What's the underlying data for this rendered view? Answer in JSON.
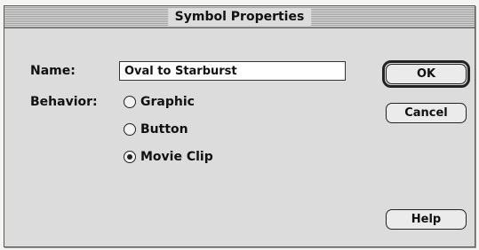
{
  "dialog": {
    "title": "Symbol Properties",
    "name_label": "Name:",
    "name_value": "Oval to Starburst",
    "behavior_label": "Behavior:",
    "behavior_options": [
      {
        "label": "Graphic",
        "selected": false
      },
      {
        "label": "Button",
        "selected": false
      },
      {
        "label": "Movie Clip",
        "selected": true
      }
    ],
    "buttons": {
      "ok": "OK",
      "cancel": "Cancel",
      "help": "Help"
    }
  }
}
